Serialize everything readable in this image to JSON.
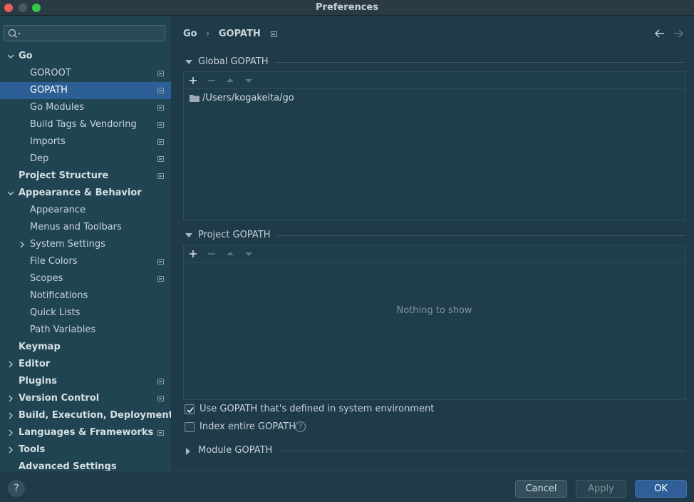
{
  "window": {
    "title": "Preferences"
  },
  "search": {
    "placeholder": ""
  },
  "sidebar": {
    "items": [
      {
        "label": "Go",
        "level": 0,
        "bold": true,
        "arrow": "down",
        "badge": false,
        "selected": false
      },
      {
        "label": "GOROOT",
        "level": 1,
        "bold": false,
        "arrow": "none",
        "badge": true,
        "selected": false
      },
      {
        "label": "GOPATH",
        "level": 1,
        "bold": false,
        "arrow": "none",
        "badge": true,
        "selected": true
      },
      {
        "label": "Go Modules",
        "level": 1,
        "bold": false,
        "arrow": "none",
        "badge": true,
        "selected": false
      },
      {
        "label": "Build Tags & Vendoring",
        "level": 1,
        "bold": false,
        "arrow": "none",
        "badge": true,
        "selected": false
      },
      {
        "label": "Imports",
        "level": 1,
        "bold": false,
        "arrow": "none",
        "badge": true,
        "selected": false
      },
      {
        "label": "Dep",
        "level": 1,
        "bold": false,
        "arrow": "none",
        "badge": true,
        "selected": false
      },
      {
        "label": "Project Structure",
        "level": 0,
        "bold": true,
        "arrow": "none",
        "badge": true,
        "selected": false
      },
      {
        "label": "Appearance & Behavior",
        "level": 0,
        "bold": true,
        "arrow": "down",
        "badge": false,
        "selected": false
      },
      {
        "label": "Appearance",
        "level": 1,
        "bold": false,
        "arrow": "none",
        "badge": false,
        "selected": false
      },
      {
        "label": "Menus and Toolbars",
        "level": 1,
        "bold": false,
        "arrow": "none",
        "badge": false,
        "selected": false
      },
      {
        "label": "System Settings",
        "level": 1,
        "bold": false,
        "arrow": "right",
        "badge": false,
        "selected": false
      },
      {
        "label": "File Colors",
        "level": 1,
        "bold": false,
        "arrow": "none",
        "badge": true,
        "selected": false
      },
      {
        "label": "Scopes",
        "level": 1,
        "bold": false,
        "arrow": "none",
        "badge": true,
        "selected": false
      },
      {
        "label": "Notifications",
        "level": 1,
        "bold": false,
        "arrow": "none",
        "badge": false,
        "selected": false
      },
      {
        "label": "Quick Lists",
        "level": 1,
        "bold": false,
        "arrow": "none",
        "badge": false,
        "selected": false
      },
      {
        "label": "Path Variables",
        "level": 1,
        "bold": false,
        "arrow": "none",
        "badge": false,
        "selected": false
      },
      {
        "label": "Keymap",
        "level": 0,
        "bold": true,
        "arrow": "none",
        "badge": false,
        "selected": false
      },
      {
        "label": "Editor",
        "level": 0,
        "bold": true,
        "arrow": "right",
        "badge": false,
        "selected": false
      },
      {
        "label": "Plugins",
        "level": 0,
        "bold": true,
        "arrow": "none",
        "badge": true,
        "selected": false
      },
      {
        "label": "Version Control",
        "level": 0,
        "bold": true,
        "arrow": "right",
        "badge": true,
        "selected": false
      },
      {
        "label": "Build, Execution, Deployment",
        "level": 0,
        "bold": true,
        "arrow": "right",
        "badge": false,
        "selected": false
      },
      {
        "label": "Languages & Frameworks",
        "level": 0,
        "bold": true,
        "arrow": "right",
        "badge": true,
        "selected": false
      },
      {
        "label": "Tools",
        "level": 0,
        "bold": true,
        "arrow": "right",
        "badge": false,
        "selected": false
      },
      {
        "label": "Advanced Settings",
        "level": 0,
        "bold": true,
        "arrow": "none",
        "badge": false,
        "selected": false
      }
    ]
  },
  "breadcrumb": {
    "parent": "Go",
    "separator": "›",
    "current": "GOPATH"
  },
  "global_gopath": {
    "title": "Global GOPATH",
    "paths": [
      "/Users/kogakeita/go"
    ]
  },
  "project_gopath": {
    "title": "Project GOPATH",
    "empty_text": "Nothing to show"
  },
  "options": {
    "use_system_gopath": {
      "label": "Use GOPATH that's defined in system environment",
      "checked": true
    },
    "index_entire_gopath": {
      "label": "Index entire GOPATH",
      "checked": false,
      "help": "?"
    }
  },
  "module_gopath": {
    "title": "Module GOPATH"
  },
  "footer": {
    "help": "?",
    "cancel": "Cancel",
    "apply": "Apply",
    "ok": "OK"
  },
  "colors": {
    "accent": "#2c5f95",
    "background": "#1f3a48",
    "sidebar": "#214453"
  }
}
